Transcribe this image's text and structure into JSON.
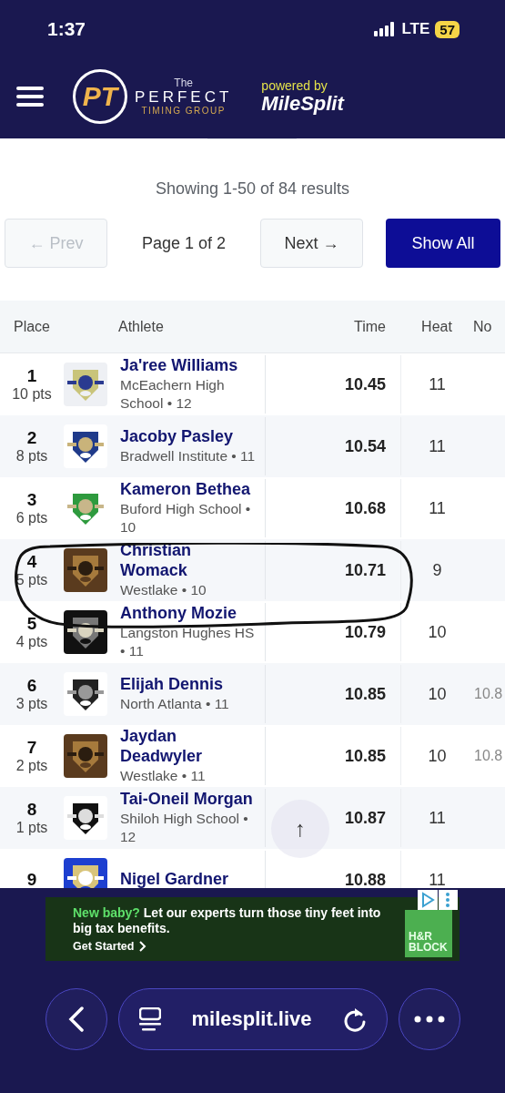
{
  "status_bar": {
    "time": "1:37",
    "network": "LTE",
    "battery": "57"
  },
  "header": {
    "logo_top": "The",
    "logo_letters": "PT",
    "logo_name": "PERFECT",
    "logo_sub": "TIMING GROUP",
    "powered_by": "powered by",
    "partner": "MileSplit"
  },
  "results": {
    "summary": "Showing 1-50 of 84 results"
  },
  "pagination": {
    "prev": {
      "label": "← Prev",
      "disabled": true
    },
    "page": "Page 1 of 2",
    "next": {
      "label": "Next →",
      "disabled": false
    },
    "show_all": "Show All"
  },
  "table": {
    "columns": [
      "Place",
      "Athlete",
      "Time",
      "Heat",
      "No"
    ],
    "rows": [
      {
        "place": "1",
        "points": "10 pts",
        "name": "Ja'ree Williams",
        "school": "McEachern High School • 12",
        "time": "10.45",
        "heat": "11"
      },
      {
        "place": "2",
        "points": "8 pts",
        "name": "Jacoby Pasley",
        "school": "Bradwell Institute • 11",
        "time": "10.54",
        "heat": "11"
      },
      {
        "place": "3",
        "points": "6 pts",
        "name": "Kameron Bethea",
        "school": "Buford High School • 10",
        "time": "10.68",
        "heat": "11"
      },
      {
        "place": "4",
        "points": "5 pts",
        "name": "Christian Womack",
        "school": "Westlake • 10",
        "time": "10.71",
        "heat": "9"
      },
      {
        "place": "5",
        "points": "4 pts",
        "name": "Anthony Mozie",
        "school": "Langston Hughes HS • 11",
        "time": "10.79",
        "heat": "10"
      },
      {
        "place": "6",
        "points": "3 pts",
        "name": "Elijah Dennis",
        "school": "North Atlanta • 11",
        "time": "10.85",
        "heat": "10",
        "column_6": "10.8"
      },
      {
        "place": "7",
        "points": "2 pts",
        "name": "Jaydan Deadwyler",
        "school": "Westlake • 11",
        "time": "10.85",
        "heat": "10",
        "column_6": "10.8"
      },
      {
        "place": "8",
        "points": "1 pts",
        "name": "Tai-Oneil Morgan",
        "school": "Shiloh High School • 12",
        "time": "10.87",
        "heat": "11"
      },
      {
        "place": "9",
        "name": "Nigel Gardner",
        "time": "10.88",
        "heat": "11"
      }
    ]
  },
  "scroll_top": "↑",
  "ad": {
    "highlight": "New baby?",
    "text": "Let our experts turn those tiny feet into big tax benefits.",
    "cta": "Get Started",
    "brand": "H&R BLOCK"
  },
  "browser": {
    "url": "milesplit.live"
  }
}
